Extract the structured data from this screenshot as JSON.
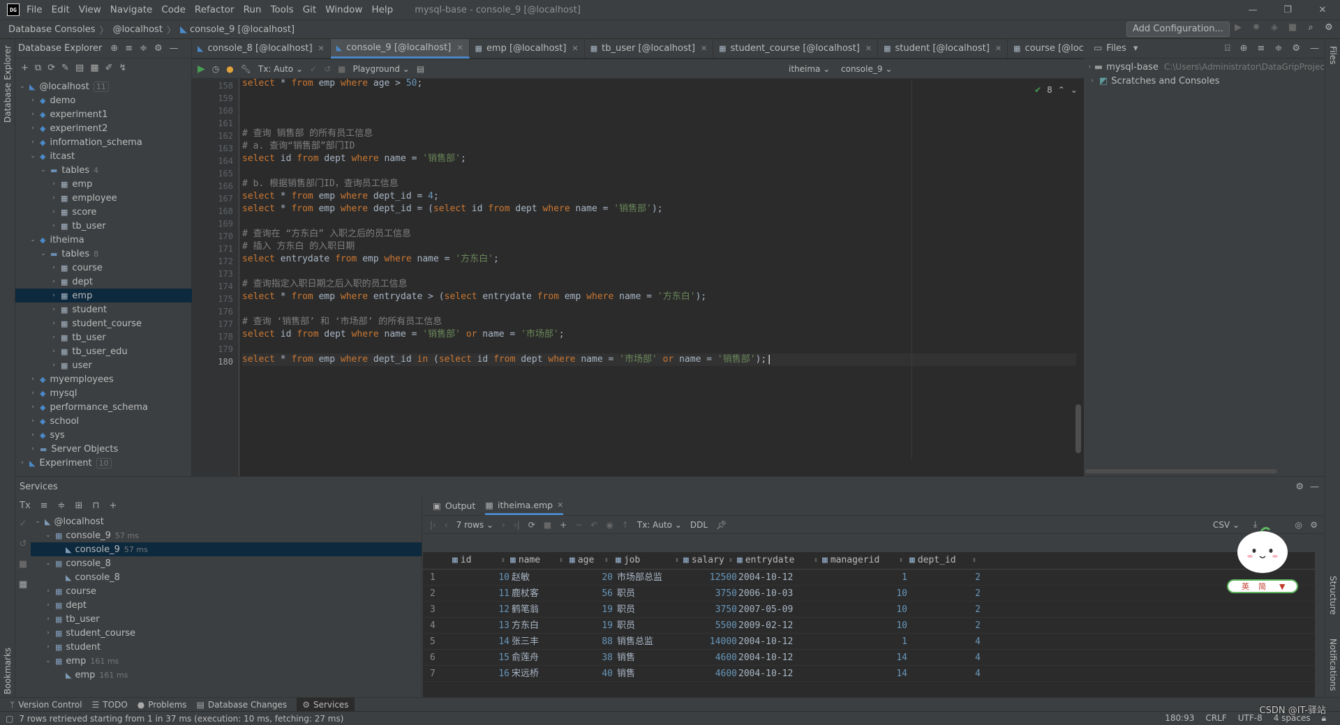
{
  "titlebar": {
    "logo": "DG",
    "menu": [
      "File",
      "Edit",
      "View",
      "Navigate",
      "Code",
      "Refactor",
      "Run",
      "Tools",
      "Git",
      "Window",
      "Help"
    ],
    "window_title": "mysql-base - console_9 [@localhost]"
  },
  "navbar": {
    "crumbs": [
      "Database Consoles",
      "@localhost",
      "console_9 [@localhost]"
    ],
    "add_config": "Add Configuration..."
  },
  "db_explorer": {
    "title": "Database Explorer",
    "tree": [
      {
        "label": "@localhost",
        "count": "11",
        "indent": 0,
        "open": true,
        "type": "host"
      },
      {
        "label": "demo",
        "indent": 1,
        "type": "db"
      },
      {
        "label": "experiment1",
        "indent": 1,
        "type": "db"
      },
      {
        "label": "experiment2",
        "indent": 1,
        "type": "db"
      },
      {
        "label": "information_schema",
        "indent": 1,
        "type": "db"
      },
      {
        "label": "itcast",
        "indent": 1,
        "open": true,
        "type": "db"
      },
      {
        "label": "tables",
        "count": "4",
        "indent": 2,
        "open": true,
        "type": "folder"
      },
      {
        "label": "emp",
        "indent": 3,
        "type": "table"
      },
      {
        "label": "employee",
        "indent": 3,
        "type": "table"
      },
      {
        "label": "score",
        "indent": 3,
        "type": "table"
      },
      {
        "label": "tb_user",
        "indent": 3,
        "type": "table"
      },
      {
        "label": "itheima",
        "indent": 1,
        "open": true,
        "type": "db"
      },
      {
        "label": "tables",
        "count": "8",
        "indent": 2,
        "open": true,
        "type": "folder"
      },
      {
        "label": "course",
        "indent": 3,
        "type": "table"
      },
      {
        "label": "dept",
        "indent": 3,
        "type": "table"
      },
      {
        "label": "emp",
        "indent": 3,
        "type": "table",
        "selected": true
      },
      {
        "label": "student",
        "indent": 3,
        "type": "table"
      },
      {
        "label": "student_course",
        "indent": 3,
        "type": "table"
      },
      {
        "label": "tb_user",
        "indent": 3,
        "type": "table"
      },
      {
        "label": "tb_user_edu",
        "indent": 3,
        "type": "table"
      },
      {
        "label": "user",
        "indent": 3,
        "type": "table"
      },
      {
        "label": "myemployees",
        "indent": 1,
        "type": "db"
      },
      {
        "label": "mysql",
        "indent": 1,
        "type": "db"
      },
      {
        "label": "performance_schema",
        "indent": 1,
        "type": "db"
      },
      {
        "label": "school",
        "indent": 1,
        "type": "db"
      },
      {
        "label": "sys",
        "indent": 1,
        "type": "db"
      },
      {
        "label": "Server Objects",
        "indent": 1,
        "type": "folder"
      },
      {
        "label": "Experiment",
        "count": "10",
        "indent": 0,
        "type": "host"
      }
    ]
  },
  "tabs": [
    {
      "label": "console_8 [@localhost]",
      "type": "console"
    },
    {
      "label": "console_9 [@localhost]",
      "type": "console",
      "active": true
    },
    {
      "label": "emp [@localhost]",
      "type": "table"
    },
    {
      "label": "tb_user [@localhost]",
      "type": "table"
    },
    {
      "label": "student_course [@localhost]",
      "type": "table"
    },
    {
      "label": "student [@localhost]",
      "type": "table"
    },
    {
      "label": "course [@localhost]",
      "type": "table"
    }
  ],
  "editor_toolbar": {
    "tx": "Tx: Auto",
    "playground": "Playground",
    "schema": "itheima",
    "console": "console_9"
  },
  "editor": {
    "inspection_count": "8",
    "lines": [
      {
        "n": "158",
        "tokens": [
          [
            "kw",
            "select "
          ],
          [
            "id",
            "* "
          ],
          [
            "kw",
            "from "
          ],
          [
            "id",
            "emp "
          ],
          [
            "kw",
            "where "
          ],
          [
            "id",
            "age > "
          ],
          [
            "num",
            "50"
          ],
          [
            "id",
            ";"
          ]
        ]
      },
      {
        "n": "159",
        "tokens": []
      },
      {
        "n": "160",
        "tokens": []
      },
      {
        "n": "161",
        "tokens": []
      },
      {
        "n": "162",
        "tokens": [
          [
            "cm",
            "# 查询 销售部 的所有员工信息"
          ]
        ]
      },
      {
        "n": "163",
        "tokens": [
          [
            "cm",
            "# a. 查询“销售部”部门ID"
          ]
        ]
      },
      {
        "n": "164",
        "tokens": [
          [
            "kw",
            "select "
          ],
          [
            "id",
            "id "
          ],
          [
            "kw",
            "from "
          ],
          [
            "id",
            "dept "
          ],
          [
            "kw",
            "where "
          ],
          [
            "id",
            "name = "
          ],
          [
            "str",
            "'销售部'"
          ],
          [
            "id",
            ";"
          ]
        ]
      },
      {
        "n": "165",
        "tokens": []
      },
      {
        "n": "166",
        "tokens": [
          [
            "cm",
            "# b. 根据销售部门ID，查询员工信息"
          ]
        ]
      },
      {
        "n": "167",
        "tokens": [
          [
            "kw",
            "select "
          ],
          [
            "id",
            "* "
          ],
          [
            "kw",
            "from "
          ],
          [
            "id",
            "emp "
          ],
          [
            "kw",
            "where "
          ],
          [
            "id",
            "dept_id = "
          ],
          [
            "num",
            "4"
          ],
          [
            "id",
            ";"
          ]
        ]
      },
      {
        "n": "168",
        "tokens": [
          [
            "kw",
            "select "
          ],
          [
            "id",
            "* "
          ],
          [
            "kw",
            "from "
          ],
          [
            "id",
            "emp "
          ],
          [
            "kw",
            "where "
          ],
          [
            "id",
            "dept_id = ("
          ],
          [
            "kw",
            "select "
          ],
          [
            "id",
            "id "
          ],
          [
            "kw",
            "from "
          ],
          [
            "id",
            "dept "
          ],
          [
            "kw",
            "where "
          ],
          [
            "id",
            "name = "
          ],
          [
            "str",
            "'销售部'"
          ],
          [
            "id",
            ");"
          ]
        ]
      },
      {
        "n": "169",
        "tokens": []
      },
      {
        "n": "170",
        "tokens": [
          [
            "cm",
            "# 查询在 “方东白” 入职之后的员工信息"
          ]
        ]
      },
      {
        "n": "171",
        "tokens": [
          [
            "cm",
            "# 插入 方东白 的入职日期"
          ]
        ]
      },
      {
        "n": "172",
        "tokens": [
          [
            "kw",
            "select "
          ],
          [
            "id",
            "entrydate "
          ],
          [
            "kw",
            "from "
          ],
          [
            "id",
            "emp "
          ],
          [
            "kw",
            "where "
          ],
          [
            "id",
            "name = "
          ],
          [
            "str",
            "'方东白'"
          ],
          [
            "id",
            ";"
          ]
        ]
      },
      {
        "n": "173",
        "tokens": []
      },
      {
        "n": "174",
        "tokens": [
          [
            "cm",
            "# 查询指定入职日期之后入职的员工信息"
          ]
        ]
      },
      {
        "n": "175",
        "tokens": [
          [
            "kw",
            "select "
          ],
          [
            "id",
            "* "
          ],
          [
            "kw",
            "from "
          ],
          [
            "id",
            "emp "
          ],
          [
            "kw",
            "where "
          ],
          [
            "id",
            "entrydate > ("
          ],
          [
            "kw",
            "select "
          ],
          [
            "id",
            "entrydate "
          ],
          [
            "kw",
            "from "
          ],
          [
            "id",
            "emp "
          ],
          [
            "kw",
            "where "
          ],
          [
            "id",
            "name = "
          ],
          [
            "str",
            "'方东白'"
          ],
          [
            "id",
            ");"
          ]
        ]
      },
      {
        "n": "176",
        "tokens": []
      },
      {
        "n": "177",
        "tokens": [
          [
            "cm",
            "# 查询 ‘销售部’ 和 ‘市场部’ 的所有员工信息"
          ]
        ]
      },
      {
        "n": "178",
        "tokens": [
          [
            "kw",
            "select "
          ],
          [
            "id",
            "id "
          ],
          [
            "kw",
            "from "
          ],
          [
            "id",
            "dept "
          ],
          [
            "kw",
            "where "
          ],
          [
            "id",
            "name = "
          ],
          [
            "str",
            "'销售部' "
          ],
          [
            "kw",
            "or "
          ],
          [
            "id",
            "name = "
          ],
          [
            "str",
            "'市场部'"
          ],
          [
            "id",
            ";"
          ]
        ]
      },
      {
        "n": "179",
        "tokens": []
      },
      {
        "n": "180",
        "current": true,
        "tokens": [
          [
            "kw",
            "select "
          ],
          [
            "id",
            "* "
          ],
          [
            "kw",
            "from "
          ],
          [
            "id",
            "emp "
          ],
          [
            "kw",
            "where "
          ],
          [
            "id",
            "dept_id "
          ],
          [
            "kw",
            "in "
          ],
          [
            "id",
            "("
          ],
          [
            "kw",
            "select "
          ],
          [
            "id",
            "id "
          ],
          [
            "kw",
            "from "
          ],
          [
            "id",
            "dept "
          ],
          [
            "kw",
            "where "
          ],
          [
            "id",
            "name = "
          ],
          [
            "str",
            "'市场部' "
          ],
          [
            "kw",
            "or "
          ],
          [
            "id",
            "name = "
          ],
          [
            "str",
            "'销售部'"
          ],
          [
            "id",
            ");"
          ]
        ]
      }
    ]
  },
  "files_panel": {
    "title": "Files",
    "items": [
      {
        "label": "mysql-base",
        "path": "C:\\Users\\Administrator\\DataGripProjec"
      },
      {
        "label": "Scratches and Consoles",
        "path": ""
      }
    ]
  },
  "services": {
    "title": "Services",
    "tree": [
      {
        "label": "@localhost",
        "indent": 0,
        "open": true
      },
      {
        "label": "console_9",
        "time": "57 ms",
        "indent": 1,
        "open": true
      },
      {
        "label": "console_9",
        "time": "57 ms",
        "indent": 2,
        "selected": true
      },
      {
        "label": "console_8",
        "indent": 1,
        "open": true
      },
      {
        "label": "console_8",
        "indent": 2
      },
      {
        "label": "course",
        "indent": 1
      },
      {
        "label": "dept",
        "indent": 1
      },
      {
        "label": "tb_user",
        "indent": 1
      },
      {
        "label": "student_course",
        "indent": 1
      },
      {
        "label": "student",
        "indent": 1
      },
      {
        "label": "emp",
        "time": "161 ms",
        "indent": 1,
        "open": true
      },
      {
        "label": "emp",
        "time": "161 ms",
        "indent": 2
      }
    ],
    "result_tabs": [
      "Output",
      "itheima.emp"
    ],
    "rows_label": "7 rows",
    "tx": "Tx: Auto",
    "ddl": "DDL",
    "export": "CSV",
    "columns": [
      "id",
      "name",
      "age",
      "job",
      "salary",
      "entrydate",
      "managerid",
      "dept_id"
    ],
    "rows": [
      [
        "1",
        "10",
        "赵敏",
        "20",
        "市场部总监",
        "12500",
        "2004-10-12",
        "1",
        "2"
      ],
      [
        "2",
        "11",
        "鹿杖客",
        "56",
        "职员",
        "3750",
        "2006-10-03",
        "10",
        "2"
      ],
      [
        "3",
        "12",
        "鹤笔翁",
        "19",
        "职员",
        "3750",
        "2007-05-09",
        "10",
        "2"
      ],
      [
        "4",
        "13",
        "方东白",
        "19",
        "职员",
        "5500",
        "2009-02-12",
        "10",
        "2"
      ],
      [
        "5",
        "14",
        "张三丰",
        "88",
        "销售总监",
        "14000",
        "2004-10-12",
        "1",
        "4"
      ],
      [
        "6",
        "15",
        "俞莲舟",
        "38",
        "销售",
        "4600",
        "2004-10-12",
        "14",
        "4"
      ],
      [
        "7",
        "16",
        "宋远桥",
        "40",
        "销售",
        "4600",
        "2004-10-12",
        "14",
        "4"
      ]
    ]
  },
  "bottom_tools": [
    "Version Control",
    "TODO",
    "Problems",
    "Database Changes",
    "Services"
  ],
  "status": {
    "message": "7 rows retrieved starting from 1 in 37 ms (execution: 10 ms, fetching: 27 ms)",
    "pos": "180:93",
    "eol": "CRLF",
    "enc": "UTF-8",
    "indent": "4 spaces"
  },
  "stripes": {
    "left_top": "Database Explorer",
    "left_bottom": "Bookmarks",
    "right_top": "Files",
    "right_mid": "Structure",
    "right_bottom": "Notifications"
  },
  "ime": {
    "chars": [
      "英",
      "简"
    ]
  },
  "watermark": "CSDN @IT-驿站"
}
